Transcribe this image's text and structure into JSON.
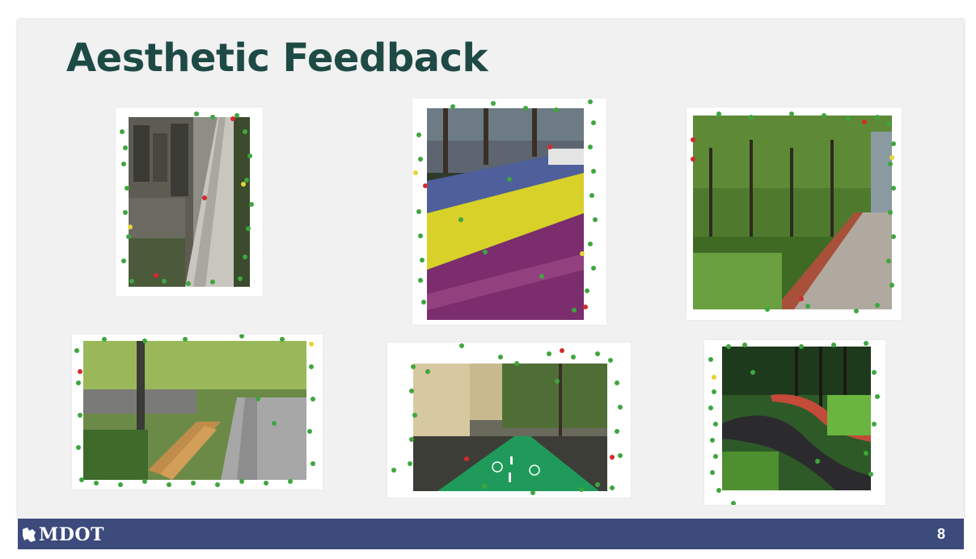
{
  "slide": {
    "title": "Aesthetic Feedback",
    "page_number": "8",
    "logo_text": "MDOT"
  },
  "photos": [
    {
      "name": "photo-sidewalk-storefronts",
      "scene": "Narrow paved sidewalk beside building"
    },
    {
      "name": "photo-flower-median",
      "scene": "Median planted with purple and yellow flowers"
    },
    {
      "name": "photo-tree-lined-walkway",
      "scene": "Tree-lined walkway with green planting"
    },
    {
      "name": "photo-bench-promenade",
      "scene": "Promenade with wooden bench and trees"
    },
    {
      "name": "photo-green-bike-lane",
      "scene": "Green painted bike lane in city street"
    },
    {
      "name": "photo-curving-path",
      "scene": "Curving path through park"
    }
  ],
  "colors": {
    "title": "#1e4a45",
    "footer": "#3c4a7c",
    "dot_green": "#3ea63e",
    "dot_red": "#d22b2b",
    "dot_yellow": "#e6d437"
  }
}
